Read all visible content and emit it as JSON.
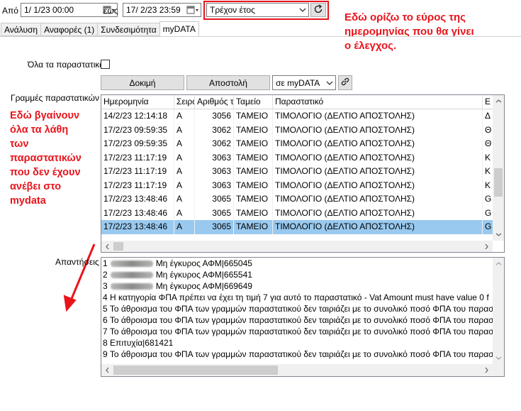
{
  "filters": {
    "from_label": "Από",
    "from_value": "1/ 1/23 00:00",
    "to_label": "εως",
    "to_value": "17/ 2/23 23:59",
    "period_value": "Τρέχον έτος"
  },
  "tabs": [
    {
      "label": "Ανάλυση"
    },
    {
      "label": "Αναφορές (1)"
    },
    {
      "label": "Συνδεσιμότητα"
    },
    {
      "label": "myDATA"
    }
  ],
  "options": {
    "all_docs_label": "Όλα τα παραστατικά"
  },
  "buttons": {
    "test_label": "Δοκιμή",
    "send_label": "Αποστολή",
    "target_value": "σε myDATA"
  },
  "grid": {
    "label": "Γραμμές παραστατικών",
    "columns": [
      "Ημερομηνία",
      "Σειρά",
      "Αριθμός τ",
      "Ταμείο",
      "Παραστατικό",
      "Ε"
    ],
    "rows": [
      [
        "14/2/23 12:14:18",
        "A",
        "3056",
        "ΤΑΜΕΙΟ",
        "ΤΙΜΟΛΟΓΙΟ (ΔΕΛΤΙΟ ΑΠΟΣΤΟΛΗΣ)",
        "Δ"
      ],
      [
        "17/2/23 09:59:35",
        "A",
        "3062",
        "ΤΑΜΕΙΟ",
        "ΤΙΜΟΛΟΓΙΟ (ΔΕΛΤΙΟ ΑΠΟΣΤΟΛΗΣ)",
        "Θ"
      ],
      [
        "17/2/23 09:59:35",
        "A",
        "3062",
        "ΤΑΜΕΙΟ",
        "ΤΙΜΟΛΟΓΙΟ (ΔΕΛΤΙΟ ΑΠΟΣΤΟΛΗΣ)",
        "Θ"
      ],
      [
        "17/2/23 11:17:19",
        "A",
        "3063",
        "ΤΑΜΕΙΟ",
        "ΤΙΜΟΛΟΓΙΟ (ΔΕΛΤΙΟ ΑΠΟΣΤΟΛΗΣ)",
        "Κ"
      ],
      [
        "17/2/23 11:17:19",
        "A",
        "3063",
        "ΤΑΜΕΙΟ",
        "ΤΙΜΟΛΟΓΙΟ (ΔΕΛΤΙΟ ΑΠΟΣΤΟΛΗΣ)",
        "Κ"
      ],
      [
        "17/2/23 11:17:19",
        "A",
        "3063",
        "ΤΑΜΕΙΟ",
        "ΤΙΜΟΛΟΓΙΟ (ΔΕΛΤΙΟ ΑΠΟΣΤΟΛΗΣ)",
        "Κ"
      ],
      [
        "17/2/23 13:48:46",
        "A",
        "3065",
        "ΤΑΜΕΙΟ",
        "ΤΙΜΟΛΟΓΙΟ (ΔΕΛΤΙΟ ΑΠΟΣΤΟΛΗΣ)",
        "G"
      ],
      [
        "17/2/23 13:48:46",
        "A",
        "3065",
        "ΤΑΜΕΙΟ",
        "ΤΙΜΟΛΟΓΙΟ (ΔΕΛΤΙΟ ΑΠΟΣΤΟΛΗΣ)",
        "G"
      ],
      [
        "17/2/23 13:48:46",
        "A",
        "3065",
        "ΤΑΜΕΙΟ",
        "ΤΙΜΟΛΟΓΙΟ (ΔΕΛΤΙΟ ΑΠΟΣΤΟΛΗΣ)",
        "G"
      ]
    ]
  },
  "responses": {
    "label": "Απαντήσεις",
    "lines": [
      {
        "num": "1",
        "blurred": true,
        "text": "Μη έγκυρος ΑΦΜ|665045"
      },
      {
        "num": "2",
        "blurred": true,
        "text": "Μη έγκυρος ΑΦΜ|665541"
      },
      {
        "num": "3",
        "blurred": true,
        "text": "Μη έγκυρος ΑΦΜ|669649"
      },
      {
        "num": "4",
        "blurred": false,
        "text": "Η κατηγορία ΦΠΑ πρέπει να έχει τη τιμή 7 για αυτό το παραστατικό - Vat Amount must have value 0 f"
      },
      {
        "num": "5",
        "blurred": false,
        "text": "Το άθροισμα του ΦΠΑ των γραμμών παραστατικού δεν ταιριάζει με το συνολικό ποσό ΦΠΑ του παραστ"
      },
      {
        "num": "6",
        "blurred": false,
        "text": "Το άθροισμα του ΦΠΑ των γραμμών παραστατικού δεν ταιριάζει με το συνολικό ποσό ΦΠΑ του παραστ"
      },
      {
        "num": "7",
        "blurred": false,
        "text": "Το άθροισμα του ΦΠΑ των γραμμών παραστατικού δεν ταιριάζει με το συνολικό ποσό ΦΠΑ του παραστ"
      },
      {
        "num": "8",
        "blurred": false,
        "text": "Επιτυχία|681421"
      },
      {
        "num": "9",
        "blurred": false,
        "text": "Το άθροισμα του ΦΠΑ των γραμμών παραστατικού δεν ταιριάζει με το συνολικό ποσό ΦΠΑ του παραστ"
      }
    ]
  },
  "annotations": {
    "top_right": [
      "Εδώ ορίζω το εύρος της",
      "ημερομηνίας που θα γίνει",
      "ο έλεγχος."
    ],
    "left": [
      "Εδώ βγαίνουν",
      "όλα τα λάθη",
      "των",
      "παραστατικών",
      "που δεν έχουν",
      "ανέβει στο",
      "mydata"
    ]
  },
  "colors": {
    "annotation": "#e8141c",
    "selected_row": "#99c9ef"
  }
}
